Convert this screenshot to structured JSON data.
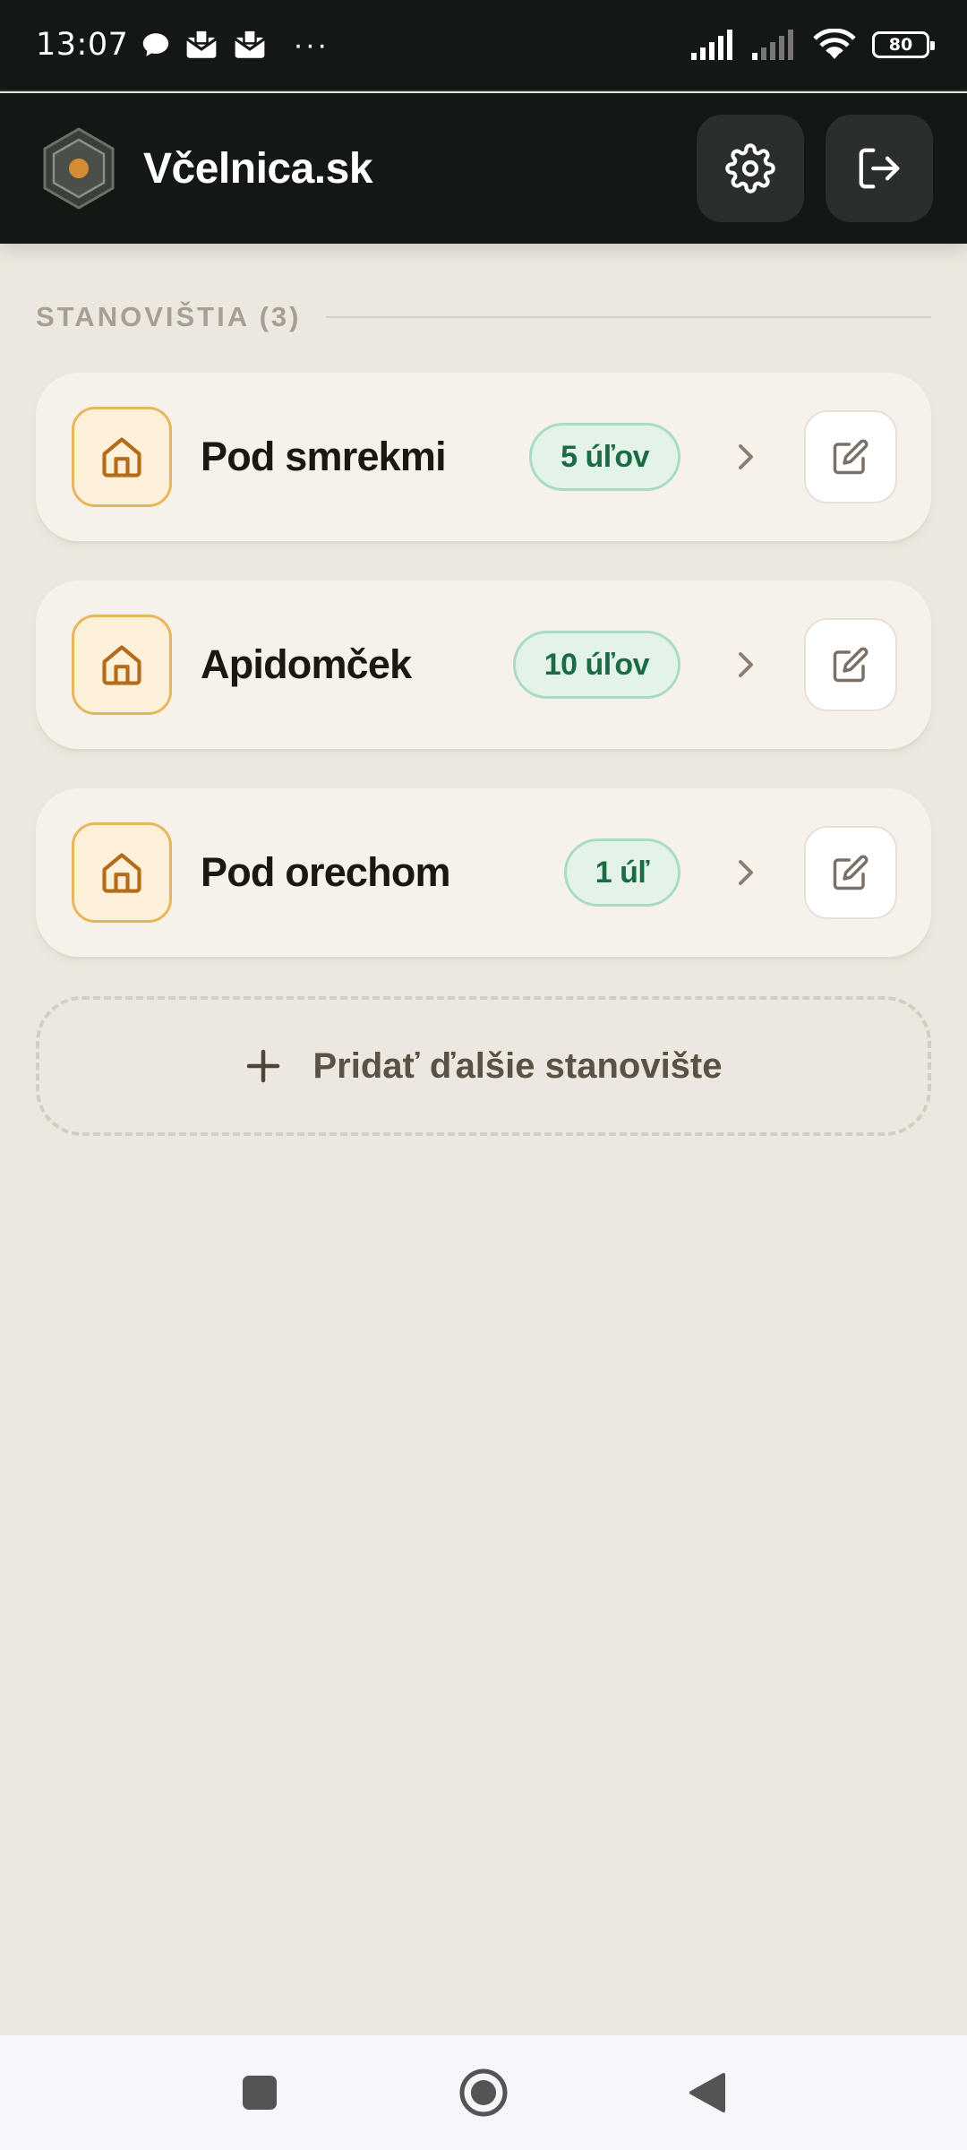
{
  "status_bar": {
    "time": "13:07",
    "more": "···",
    "battery": "80",
    "icons": [
      "chat-bubble-icon",
      "mail-icon",
      "mail-icon",
      "signal-icon",
      "signal-icon",
      "wifi-icon",
      "battery-icon"
    ]
  },
  "header": {
    "title": "Včelnica.sk",
    "logo_icon": "hexagon-logo-icon",
    "settings_icon": "gear-icon",
    "logout_icon": "logout-icon"
  },
  "section": {
    "label": "STANOVIŠTIA (3)"
  },
  "apiaries": [
    {
      "name": "Pod smrekmi",
      "hives": "5 úľov"
    },
    {
      "name": "Apidomček",
      "hives": "10 úľov"
    },
    {
      "name": "Pod orechom",
      "hives": "1 úľ"
    }
  ],
  "add_button": {
    "label": "Pridať ďalšie stanovište"
  },
  "colors": {
    "background": "#ece8df",
    "header": "#141814",
    "accent_orange": "#e9b660",
    "badge_green": "#1d6b45"
  }
}
